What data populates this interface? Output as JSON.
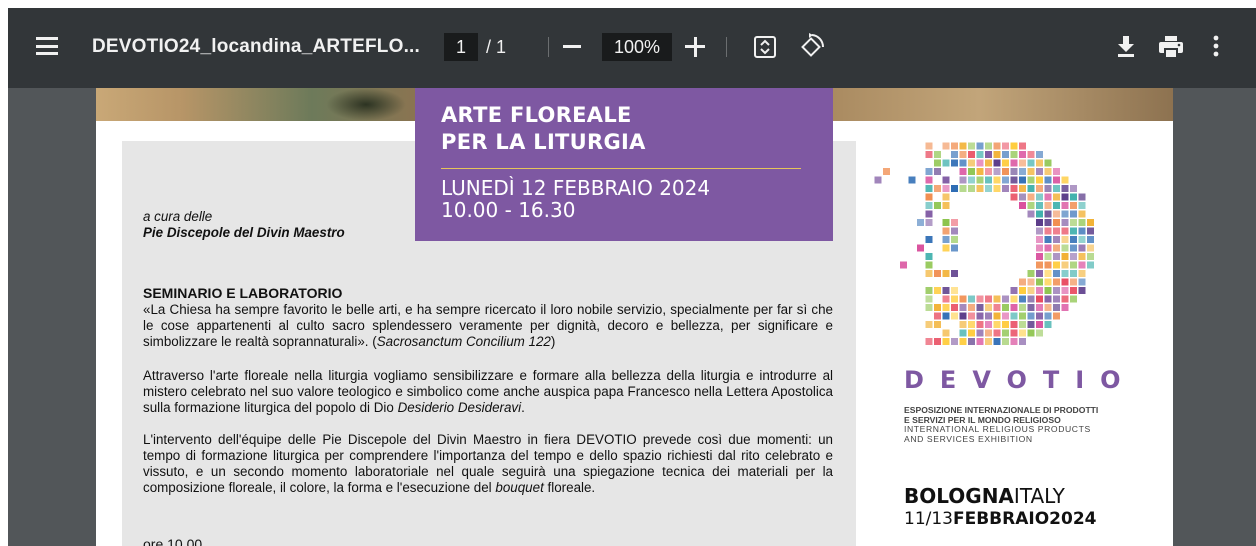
{
  "toolbar": {
    "doc_title": "DEVOTIO24_locandina_ARTEFLO...",
    "page_current": "1",
    "page_separator": "/ 1",
    "zoom": "100%"
  },
  "icons": [
    "menu-icon",
    "zoom-out-icon",
    "zoom-in-icon",
    "fit-page-icon",
    "rotate-icon",
    "download-icon",
    "print-icon",
    "more-options-icon"
  ],
  "colors": {
    "toolbar": "#323639",
    "viewer_bg": "#525659",
    "brand_purple": "#7e58a2",
    "accent_gold": "#e6c45a"
  },
  "document": {
    "banner_title_line1": "ARTE FLOREALE",
    "banner_title_line2": "PER LA LITURGIA",
    "banner_date": "LUNEDÌ 12 FEBBRAIO 2024",
    "banner_time": "10.00 - 16.30",
    "curated_by": "a cura delle",
    "organizer": "Pie Discepole del Divin Maestro",
    "section_title": "SEMINARIO E LABORATORIO",
    "para1_quote": "«La Chiesa ha sempre favorito le belle arti, e ha sempre ricercato il loro nobile servizio, specialmente per far sì che le cose appartenenti al culto sacro splendessero veramente per dignità, decoro e bellezza, per significare e simbolizzare le realtà soprannaturali». (",
    "para1_source": "Sacrosanctum Concilium 122",
    "para1_end": ")",
    "para2_main": "Attraverso l'arte floreale nella liturgia vogliamo sensibilizzare e formare alla bellezza della liturgia e introdurre al mistero celebrato nel suo valore teologico e simbolico come anche auspica papa Francesco nella Lettera Apostolica sulla formazione liturgica del popolo di Dio ",
    "para2_italic": "Desiderio Desideravi",
    "para2_end": ".",
    "para3_main": "L'intervento dell'équipe delle Pie Discepole del Divin Maestro in fiera DEVOTIO prevede così due momenti: un tempo di formazione liturgica per comprendere l'importanza del tempo e dello spazio richiesti dal rito celebrato e vissuto, e un secondo momento laboratoriale nel quale seguirà una spiegazione tecnica dei materiali per la composizione floreale, il colore, la forma e l'esecuzione del ",
    "para3_italic": "bouquet",
    "para3_end": " floreale.",
    "cut_line": "ore 10.00"
  },
  "logo": {
    "brand": "DEVOTIO",
    "tagline_it_1": "ESPOSIZIONE INTERNAZIONALE DI PRODOTTI",
    "tagline_it_2": "E SERVIZI PER IL MONDO RELIGIOSO",
    "tagline_en_1": "INTERNATIONAL RELIGIOUS PRODUCTS",
    "tagline_en_2": "AND SERVICES EXHIBITION",
    "city_bold": "BOLOGNA",
    "city_rest": "ITALY",
    "dates_prefix": "11/13",
    "dates_bold": "FEBBRAIO2024"
  }
}
